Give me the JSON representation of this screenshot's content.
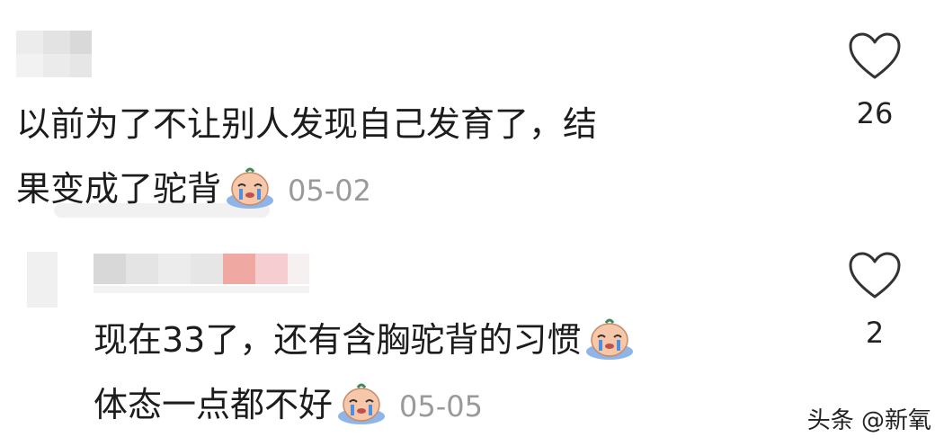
{
  "comments": [
    {
      "lines": [
        "以前为了不让别人发现自己发育了，结",
        "果变成了驼背"
      ],
      "time": "05-02",
      "like_count": "26",
      "emoji_icon": "crying-face-emoji"
    },
    {
      "lines": [
        "现在33了，还有含胸驼背的习惯",
        "体态一点都不好"
      ],
      "time": "05-05",
      "like_count": "2",
      "emoji_icon": "crying-face-emoji"
    }
  ],
  "watermark": "头条 @新氧"
}
